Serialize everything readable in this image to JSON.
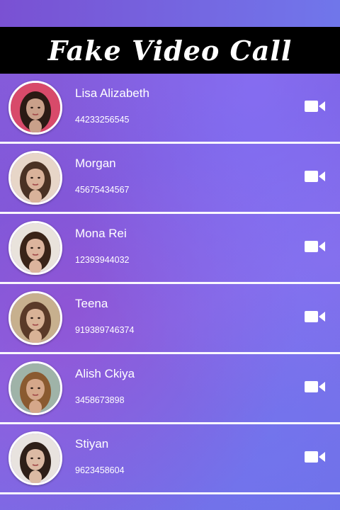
{
  "app": {
    "title": "Fake Video Call"
  },
  "contacts": [
    {
      "name": "Lisa Alizabeth",
      "phone": "44233256545",
      "tone": "#c9a08a",
      "hair": "#2b1a14",
      "bg": "#d84a6a"
    },
    {
      "name": "Morgan",
      "phone": "45675434567",
      "tone": "#d9b29a",
      "hair": "#4a3224",
      "bg": "#e7d6c8"
    },
    {
      "name": "Mona Rei",
      "phone": "12393944032",
      "tone": "#dcb49d",
      "hair": "#3a2418",
      "bg": "#e9e3dc"
    },
    {
      "name": "Teena",
      "phone": "919389746374",
      "tone": "#d8b296",
      "hair": "#5a3a28",
      "bg": "#c7b08e"
    },
    {
      "name": "Alish Ckiya",
      "phone": "3458673898",
      "tone": "#d5a78a",
      "hair": "#8a5a30",
      "bg": "#9fb3a8"
    },
    {
      "name": "Stiyan",
      "phone": "9623458604",
      "tone": "#dcbaa4",
      "hair": "#2e1f18",
      "bg": "#e8e3df"
    }
  ],
  "icons": {
    "call": "video-camera-icon",
    "call_color": "#ffffff"
  }
}
